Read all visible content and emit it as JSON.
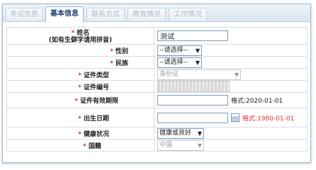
{
  "tabs": [
    {
      "label": "考点信息",
      "active": false
    },
    {
      "label": "基本信息",
      "active": true
    },
    {
      "label": "联系方式",
      "active": false
    },
    {
      "label": "教育情况",
      "active": false
    },
    {
      "label": "工作情况",
      "active": false
    }
  ],
  "form": {
    "required_mark": "*",
    "name": {
      "label": "姓名",
      "sub_label": "(如有生僻字请用拼音)",
      "value": "测试"
    },
    "gender": {
      "label": "性别",
      "selected": "--请选择--"
    },
    "ethnicity": {
      "label": "民族",
      "selected": "--请选择--"
    },
    "id_type": {
      "label": "证件类型",
      "selected": "身份证",
      "disabled": true
    },
    "id_number": {
      "label": "证件编号",
      "masked": true
    },
    "id_valid_until": {
      "label": "证件有效期限",
      "value": "",
      "hint": "格式:2020-01-01"
    },
    "birth_date": {
      "label": "出生日期",
      "value": "",
      "hint": "格式:1980-01-01",
      "hint_color": "#e03030"
    },
    "health": {
      "label": "健康状况",
      "selected": "健康或良好"
    },
    "nationality": {
      "label": "国籍",
      "selected": "中国",
      "disabled": true
    }
  },
  "colors": {
    "required": "#e03030",
    "border": "#7f9db9",
    "tab_active_text": "#1f3f6e"
  }
}
